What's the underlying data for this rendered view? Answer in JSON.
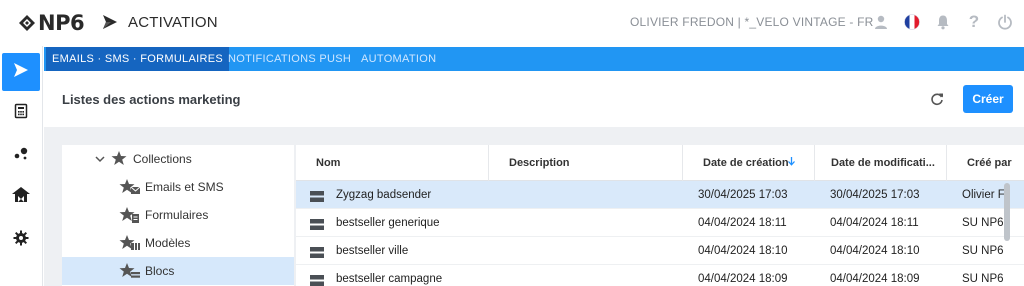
{
  "brand": {
    "logo_text": "NP6",
    "app_title": "ACTIVATION"
  },
  "header_right": {
    "user_info": "OLIVIER FREDON  |  *_VELO VINTAGE - FR"
  },
  "tabs": [
    {
      "label": "EMAILS · SMS · FORMULAIRES",
      "active": true
    },
    {
      "label": "NOTIFICATIONS PUSH",
      "active": false
    },
    {
      "label": "AUTOMATION",
      "active": false
    }
  ],
  "page": {
    "title": "Listes des actions marketing",
    "create_label": "Créer"
  },
  "tree": {
    "items": [
      {
        "label": "Collections",
        "icon": "star-icon",
        "expanded": true
      },
      {
        "label": "Emails et SMS",
        "icon": "star-email-icon"
      },
      {
        "label": "Formulaires",
        "icon": "star-form-icon"
      },
      {
        "label": "Modèles",
        "icon": "star-template-icon"
      },
      {
        "label": "Blocs",
        "icon": "star-blocks-icon",
        "selected": true
      }
    ]
  },
  "table": {
    "columns": [
      "Nom",
      "Description",
      "Date de création",
      "Date de modificati...",
      "Créé par"
    ],
    "sort": {
      "column": "Date de création",
      "direction": "desc"
    },
    "rows": [
      {
        "name": "Zygzag badsender",
        "description": "",
        "created": "30/04/2025 17:03",
        "modified": "30/04/2025 17:03",
        "author": "Olivier Fr",
        "selected": true
      },
      {
        "name": "bestseller generique",
        "description": "",
        "created": "04/04/2024 18:11",
        "modified": "04/04/2024 18:11",
        "author": "SU NP6"
      },
      {
        "name": "bestseller ville",
        "description": "",
        "created": "04/04/2024 18:10",
        "modified": "04/04/2024 18:10",
        "author": "SU NP6"
      },
      {
        "name": "bestseller campagne",
        "description": "",
        "created": "04/04/2024 18:09",
        "modified": "04/04/2024 18:09",
        "author": "SU NP6"
      }
    ]
  },
  "colors": {
    "accent": "#1e90ff",
    "tab_bar": "#2196f3",
    "tab_active": "#1565c0",
    "selection": "#d9e9fa"
  }
}
